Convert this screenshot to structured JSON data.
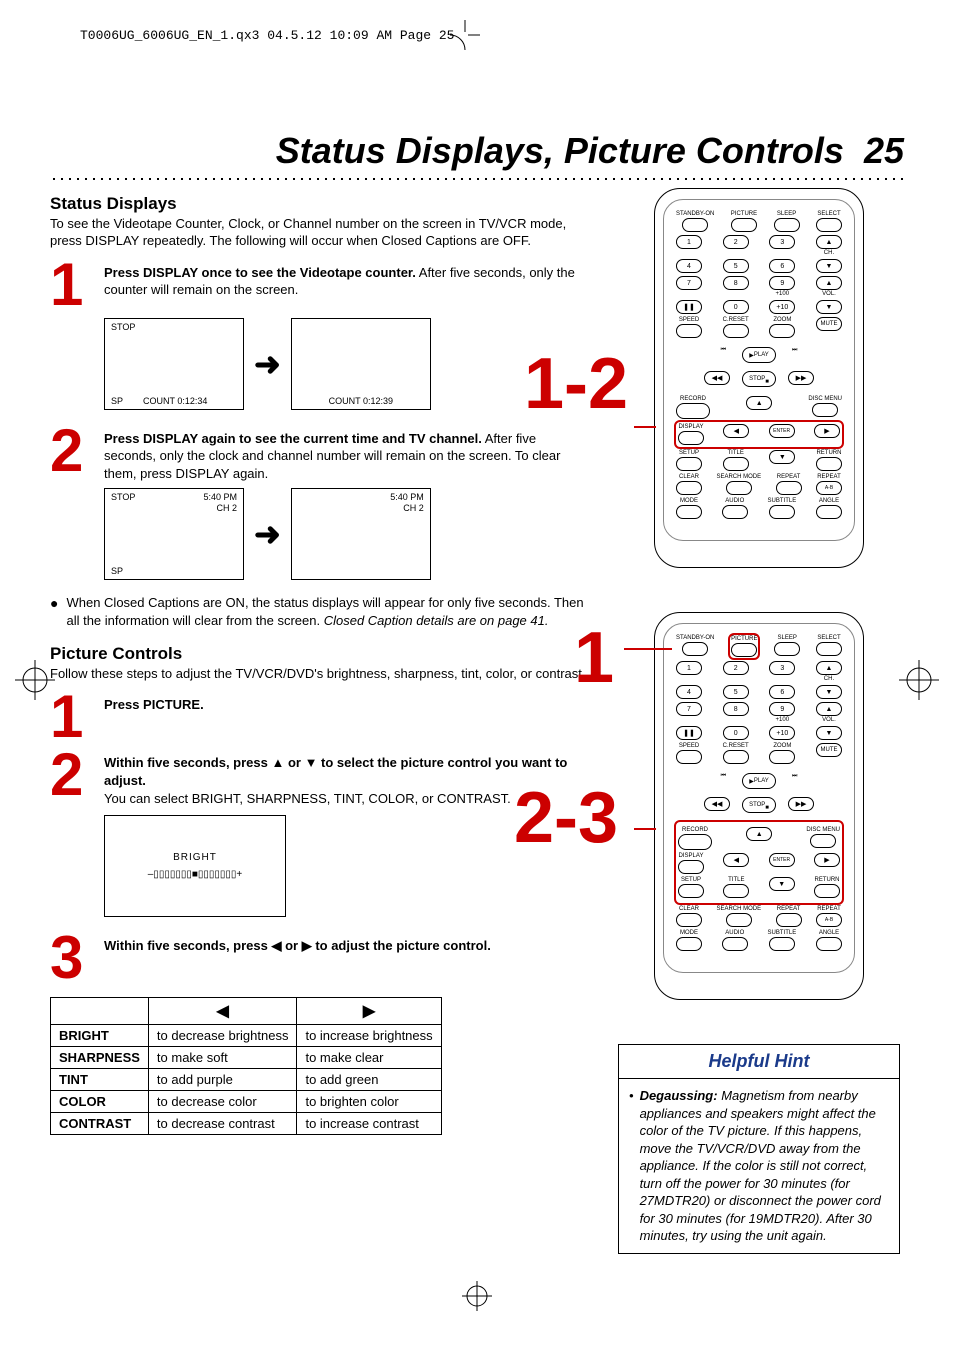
{
  "header_print": "T0006UG_6006UG_EN_1.qx3  04.5.12  10:09 AM  Page 25",
  "page_title_text": "Status Displays, Picture Controls",
  "page_number": "25",
  "status_heading": "Status Displays",
  "status_intro": "To see the Videotape Counter, Clock, or Channel number on the screen in TV/VCR mode, press DISPLAY repeatedly. The following will occur when Closed Captions are OFF.",
  "steps_status": [
    {
      "num": "1",
      "bold": "Press DISPLAY once to see the Videotape counter.",
      "rest": " After five seconds, only the counter will remain on the screen."
    },
    {
      "num": "2",
      "bold": "Press DISPLAY again to see the current time and TV channel.",
      "rest": " After five seconds, only the clock and channel number will remain on the screen. To clear them, press DISPLAY again."
    }
  ],
  "screens": {
    "stop": "STOP",
    "sp": "SP",
    "count1": "COUNT  0:12:34",
    "count2": "COUNT  0:12:39",
    "time": "5:40 PM",
    "ch": "CH 2"
  },
  "bullet_cc": "When Closed Captions are ON, the status displays will appear for only five seconds. Then all the information will clear from the screen.",
  "bullet_cc_italic": "Closed Caption details are on page 41.",
  "picture_heading": "Picture Controls",
  "picture_intro": "Follow these steps to adjust the TV/VCR/DVD's brightness, sharpness, tint, color, or contrast.",
  "steps_picture": [
    {
      "num": "1",
      "bold": "Press PICTURE.",
      "rest": ""
    },
    {
      "num": "2",
      "bold": "Within five seconds, press ▲ or ▼ to select the picture control you want to adjust.",
      "rest": " You can select BRIGHT, SHARPNESS, TINT, COLOR, or CONTRAST."
    },
    {
      "num": "3",
      "bold": "Within five seconds, press ◀ or ▶ to adjust the picture control.",
      "rest": ""
    }
  ],
  "bright_label": "BRIGHT",
  "bright_bar": "–▯▯▯▯▯▯▯■▯▯▯▯▯▯▯+",
  "table": {
    "rows": [
      [
        "BRIGHT",
        "to decrease brightness",
        "to increase brightness"
      ],
      [
        "SHARPNESS",
        "to make soft",
        "to make clear"
      ],
      [
        "TINT",
        "to add purple",
        "to add green"
      ],
      [
        "COLOR",
        "to decrease color",
        "to brighten color"
      ],
      [
        "CONTRAST",
        "to decrease contrast",
        "to increase contrast"
      ]
    ]
  },
  "remote_bignums": {
    "top": "1-2",
    "mid": "1",
    "bot": "2-3"
  },
  "remote_labels": {
    "row1": [
      "STANDBY-ON",
      "PICTURE",
      "SLEEP",
      "SELECT"
    ],
    "nums": [
      "1",
      "2",
      "3",
      "4",
      "5",
      "6",
      "7",
      "8",
      "9",
      "0",
      "+10",
      "+100"
    ],
    "ch": "CH.",
    "vol": "VOL.",
    "row_speed": [
      "SPEED",
      "C.RESET",
      "ZOOM"
    ],
    "pause": "❚❚",
    "mute": "MUTE",
    "play": "PLAY",
    "stop": "STOP",
    "record": "RECORD",
    "disc": "DISC MENU",
    "display": "DISPLAY",
    "setup": "SETUP",
    "title": "TITLE",
    "return": "RETURN",
    "enter": "ENTER",
    "row_clear": [
      "CLEAR",
      "SEARCH MODE",
      "REPEAT",
      "REPEAT"
    ],
    "ab": "A-B",
    "row_mode": [
      "MODE",
      "AUDIO",
      "SUBTITLE",
      "ANGLE"
    ],
    "skipb": "⏮",
    "skipf": "⏭",
    "rev": "◀◀",
    "fwd": "▶▶"
  },
  "hint_title": "Helpful Hint",
  "hint_bold": "Degaussing:",
  "hint_body": " Magnetism from nearby appliances and speakers might affect the color of the TV picture. If this happens, move the TV/VCR/DVD away from the appliance. If the color is still not correct, turn off the power for 30 minutes (for 27MDTR20) or disconnect the power cord for 30 minutes (for 19MDTR20). After 30 minutes, try using the unit again."
}
